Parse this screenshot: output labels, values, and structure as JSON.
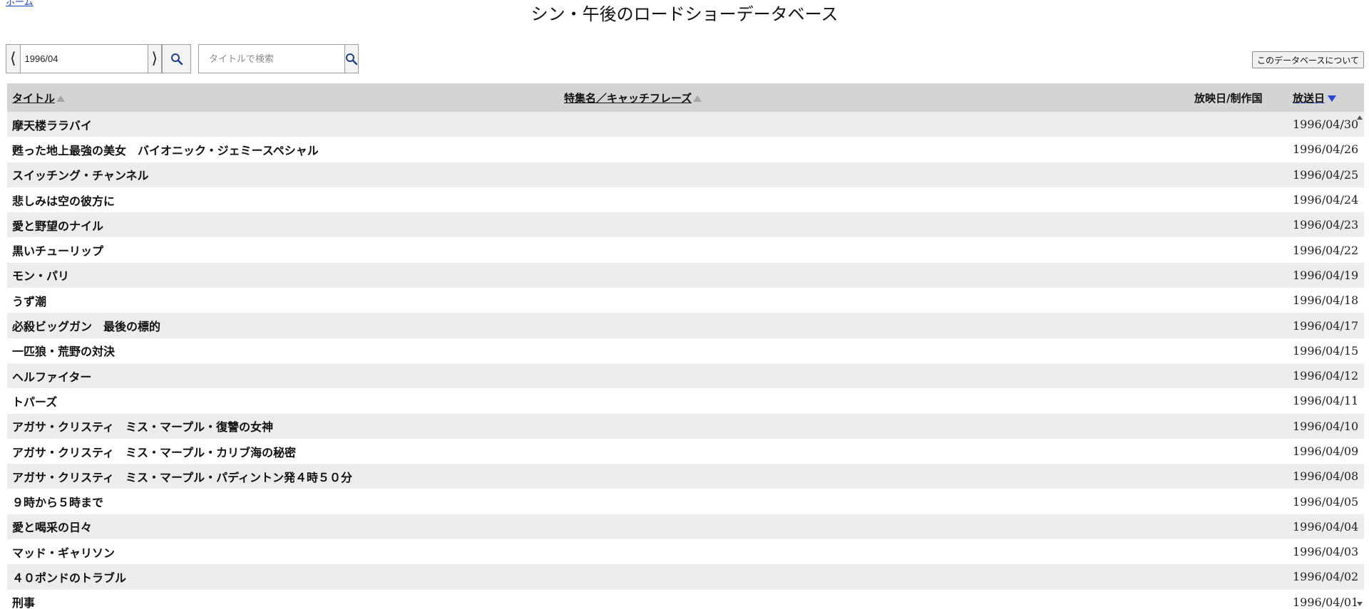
{
  "nav": {
    "home_link": "ホーム"
  },
  "header": {
    "title": "シン・午後のロードショーデータベース"
  },
  "toolbar": {
    "prev_label": "⟨",
    "next_label": "⟩",
    "month_value": "1996/04",
    "search_placeholder": "タイトルで検索",
    "search_value": "",
    "about_label": "このデータベースについて"
  },
  "icons": {
    "month_search": "search-icon",
    "title_search": "search-icon",
    "accent_color": "#2348d8"
  },
  "table": {
    "columns": {
      "title": "タイトル",
      "feature": "特集名／キャッチフレーズ",
      "origin": "放映日/制作国",
      "date": "放送日"
    },
    "sort": {
      "column": "date",
      "direction": "descending"
    },
    "rows": [
      {
        "title": "摩天楼ララバイ",
        "feature": "",
        "origin": "",
        "date": "1996/04/30"
      },
      {
        "title": "甦った地上最強の美女　バイオニック・ジェミースペシャル",
        "feature": "",
        "origin": "",
        "date": "1996/04/26"
      },
      {
        "title": "スイッチング・チャンネル",
        "feature": "",
        "origin": "",
        "date": "1996/04/25"
      },
      {
        "title": "悲しみは空の彼方に",
        "feature": "",
        "origin": "",
        "date": "1996/04/24"
      },
      {
        "title": "愛と野望のナイル",
        "feature": "",
        "origin": "",
        "date": "1996/04/23"
      },
      {
        "title": "黒いチューリップ",
        "feature": "",
        "origin": "",
        "date": "1996/04/22"
      },
      {
        "title": "モン・パリ",
        "feature": "",
        "origin": "",
        "date": "1996/04/19"
      },
      {
        "title": "うず潮",
        "feature": "",
        "origin": "",
        "date": "1996/04/18"
      },
      {
        "title": "必殺ビッグガン　最後の標的",
        "feature": "",
        "origin": "",
        "date": "1996/04/17"
      },
      {
        "title": "一匹狼・荒野の対決",
        "feature": "",
        "origin": "",
        "date": "1996/04/15"
      },
      {
        "title": "ヘルファイター",
        "feature": "",
        "origin": "",
        "date": "1996/04/12"
      },
      {
        "title": "トパーズ",
        "feature": "",
        "origin": "",
        "date": "1996/04/11"
      },
      {
        "title": "アガサ・クリスティ　ミス・マープル・復讐の女神",
        "feature": "",
        "origin": "",
        "date": "1996/04/10"
      },
      {
        "title": "アガサ・クリスティ　ミス・マープル・カリブ海の秘密",
        "feature": "",
        "origin": "",
        "date": "1996/04/09"
      },
      {
        "title": "アガサ・クリスティ　ミス・マープル・パディントン発４時５０分",
        "feature": "",
        "origin": "",
        "date": "1996/04/08"
      },
      {
        "title": "９時から５時まで",
        "feature": "",
        "origin": "",
        "date": "1996/04/05"
      },
      {
        "title": "愛と喝采の日々",
        "feature": "",
        "origin": "",
        "date": "1996/04/04"
      },
      {
        "title": "マッド・ギャリソン",
        "feature": "",
        "origin": "",
        "date": "1996/04/03"
      },
      {
        "title": "４０ポンドのトラブル",
        "feature": "",
        "origin": "",
        "date": "1996/04/02"
      },
      {
        "title": "刑事",
        "feature": "",
        "origin": "",
        "date": "1996/04/01"
      }
    ]
  }
}
